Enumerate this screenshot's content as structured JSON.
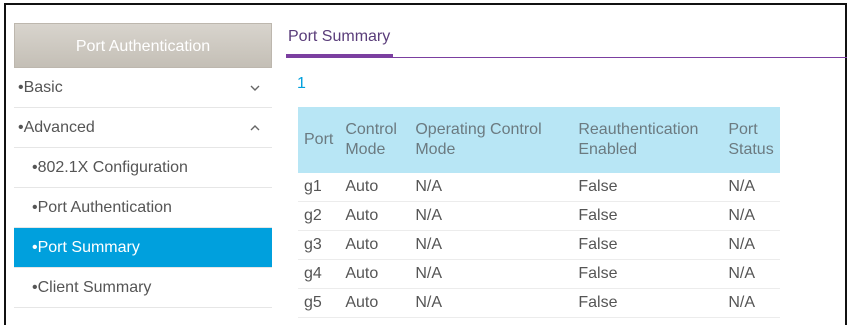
{
  "sidebar": {
    "header": "Port Authentication",
    "items": [
      {
        "label": "Basic",
        "level": 1,
        "expanded": false
      },
      {
        "label": "Advanced",
        "level": 1,
        "expanded": true
      },
      {
        "label": "802.1X Configuration",
        "level": 2
      },
      {
        "label": "Port Authentication",
        "level": 2
      },
      {
        "label": "Port Summary",
        "level": 2,
        "active": true
      },
      {
        "label": "Client Summary",
        "level": 2
      }
    ]
  },
  "main": {
    "tab": "Port Summary",
    "page": "1",
    "table": {
      "headers": [
        "Port",
        "Control Mode",
        "Operating Control Mode",
        "Reauthentication Enabled",
        "Port Status"
      ],
      "rows": [
        [
          "g1",
          "Auto",
          "N/A",
          "False",
          "N/A"
        ],
        [
          "g2",
          "Auto",
          "N/A",
          "False",
          "N/A"
        ],
        [
          "g3",
          "Auto",
          "N/A",
          "False",
          "N/A"
        ],
        [
          "g4",
          "Auto",
          "N/A",
          "False",
          "N/A"
        ],
        [
          "g5",
          "Auto",
          "N/A",
          "False",
          "N/A"
        ]
      ]
    }
  },
  "colors": {
    "accent": "#00a0dd",
    "tab_underline": "#7b3fa0",
    "table_header": "#b8e6f5",
    "sidebar_header": "#c9c4bb"
  },
  "icons": {
    "bullet": "•",
    "collapsed": "chevron-down-icon",
    "expanded": "chevron-up-icon"
  }
}
